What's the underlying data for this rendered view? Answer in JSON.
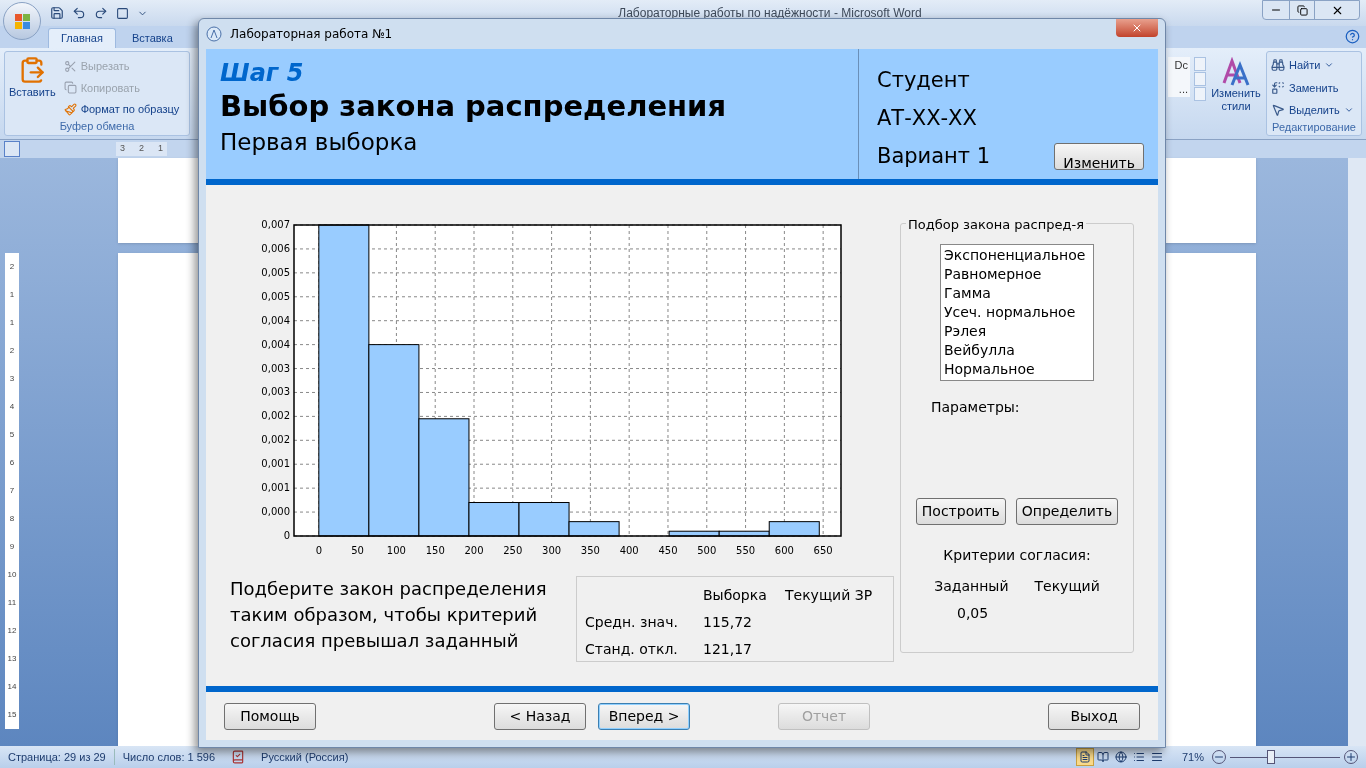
{
  "word": {
    "title": "Лабораторные работы по надёжности - Microsoft Word",
    "tabs": [
      {
        "label": "Главная",
        "selected": true
      },
      {
        "label": "Вставка",
        "selected": false
      }
    ],
    "clipboard": {
      "paste": "Вставить",
      "group_label": "Буфер обмена",
      "items": [
        {
          "kind": "cut",
          "label": "Вырезать",
          "disabled": true
        },
        {
          "kind": "copy",
          "label": "Копировать",
          "disabled": true
        },
        {
          "kind": "format",
          "label": "Формат по образцу",
          "disabled": false
        }
      ]
    },
    "styles": {
      "preview_1": "Dc",
      "preview_2": "...",
      "change_styles": "Изменить стили"
    },
    "editing": {
      "group_label": "Редактирование",
      "items": [
        {
          "kind": "find",
          "label": "Найти",
          "dropdown": true
        },
        {
          "kind": "replace",
          "label": "Заменить",
          "dropdown": false
        },
        {
          "kind": "select",
          "label": "Выделить",
          "dropdown": true
        }
      ]
    },
    "ruler": {
      "horizontal": [
        "3",
        "2",
        "1"
      ],
      "vertical": [
        "2",
        "1",
        "1",
        "2",
        "3",
        "4",
        "5",
        "6",
        "7",
        "8",
        "9",
        "10",
        "11",
        "12",
        "13",
        "14",
        "15"
      ]
    },
    "status_bar": {
      "page": "Страница: 29 из 29",
      "words": "Число слов: 1 596",
      "language": "Русский (Россия)",
      "zoom": "71%",
      "views": [
        {
          "kind": "print",
          "selected": true
        },
        {
          "kind": "reading",
          "selected": false
        },
        {
          "kind": "web",
          "selected": false
        },
        {
          "kind": "outline",
          "selected": false
        },
        {
          "kind": "draft",
          "selected": false
        }
      ],
      "zoom_slider": {
        "level": 0.37
      }
    }
  },
  "dialog": {
    "title": "Лабораторная работа №1",
    "header": {
      "step": "Шаг 5",
      "heading": "Выбор закона распределения",
      "subtitle": "Первая выборка",
      "student": "Студент",
      "group": "АТ-ХХ-ХХ",
      "variant": "Вариант 1",
      "change_button": "Изменить"
    },
    "chart_data": {
      "type": "bar",
      "x": [
        32.25,
        96.75,
        161.25,
        225.75,
        290.25,
        354.75,
        419.25,
        483.75,
        548.25,
        612.75
      ],
      "series": [
        {
          "color": "#99ccff",
          "values": [
            0.0065,
            0.004,
            0.00245,
            0.0007,
            0.0007,
            0.0003,
            0,
            0.0001,
            0.0001,
            0.0003
          ]
        }
      ],
      "grid": true,
      "xlim": [
        -32,
        673
      ],
      "ylim": [
        0,
        0.0065
      ],
      "xticks": [
        0,
        50,
        100,
        150,
        200,
        250,
        300,
        350,
        400,
        450,
        500,
        550,
        600,
        650
      ],
      "yticks": [
        {
          "value": 0,
          "label": "0"
        },
        {
          "value": 0.0005,
          "label": "0,000"
        },
        {
          "value": 0.001,
          "label": "0,001"
        },
        {
          "value": 0.0015,
          "label": "0,001"
        },
        {
          "value": 0.002,
          "label": "0,002"
        },
        {
          "value": 0.0025,
          "label": "0,002"
        },
        {
          "value": 0.003,
          "label": "0,003"
        },
        {
          "value": 0.0035,
          "label": "0,003"
        },
        {
          "value": 0.004,
          "label": "0,004"
        },
        {
          "value": 0.0045,
          "label": "0,004"
        },
        {
          "value": 0.005,
          "label": "0,005"
        },
        {
          "value": 0.0055,
          "label": "0,005"
        },
        {
          "value": 0.006,
          "label": "0,006"
        },
        {
          "value": 0.0065,
          "label": "0,007"
        }
      ]
    },
    "hint": "Подберите закон распределения таким образом, чтобы критерий согласия превышал заданный",
    "stats": {
      "columns": [
        "Выборка",
        "Текущий ЗР"
      ],
      "rows": [
        {
          "label": "Средн. знач.",
          "sample": "115,72"
        },
        {
          "label": "Станд. откл.",
          "sample": "121,17"
        }
      ]
    },
    "fit": {
      "legend": "Подбор закона распред-я",
      "laws": [
        "Экспоненциальное",
        "Равномерное",
        "Гамма",
        "Усеч. нормальное",
        "Рэлея",
        "Вейбулла",
        "Нормальное"
      ],
      "params_label": "Параметры:",
      "buttons": [
        "Построить",
        "Определить"
      ],
      "criteria_label": "Критерии согласия:",
      "columns": [
        "Заданный",
        "Текущий"
      ],
      "given": "0,05"
    },
    "footer": [
      {
        "label": "Помощь",
        "disabled": false,
        "focused": false
      },
      {
        "label": "< Назад",
        "disabled": false,
        "focused": false
      },
      {
        "label": "Вперед >",
        "disabled": false,
        "focused": true
      },
      {
        "label": "Отчет",
        "disabled": true,
        "focused": false
      },
      {
        "label": "Выход",
        "disabled": false,
        "focused": false
      }
    ]
  }
}
